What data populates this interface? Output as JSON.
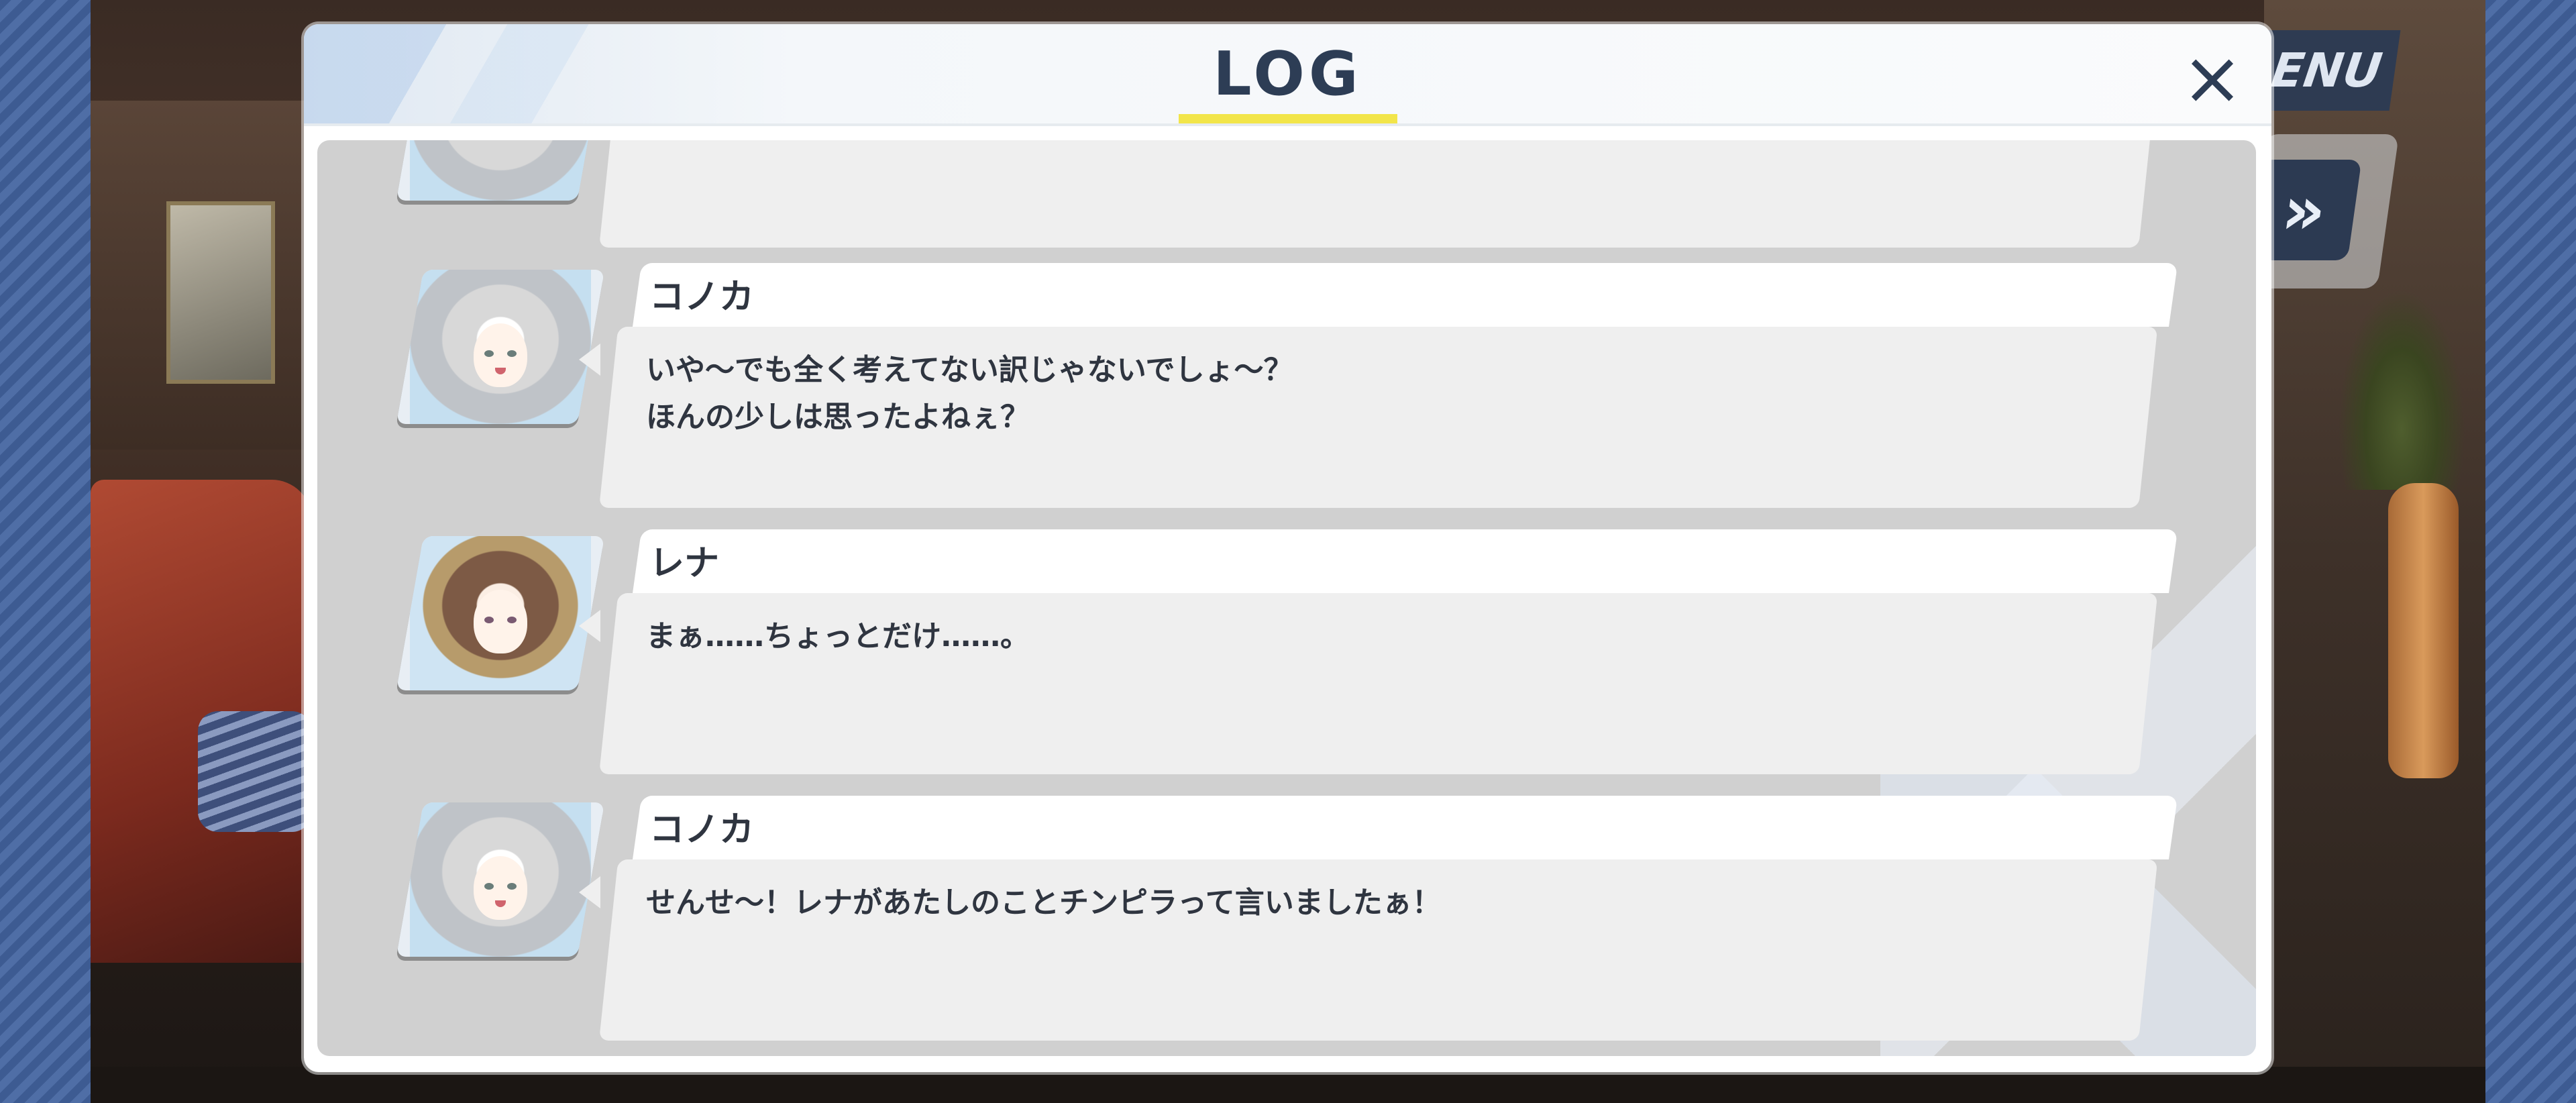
{
  "background": {
    "menu_label": "ENU",
    "skip_label": "»"
  },
  "log": {
    "title": "LOG",
    "close_icon": "×",
    "accent_color": "#f2e54a",
    "entries": [
      {
        "name": "コノカ",
        "avatar": "konoka-portrait",
        "text": "いや～でも全く考えてない訳じゃないでしょ～？\nほんの少しは思ったよねぇ？"
      },
      {
        "name": "レナ",
        "avatar": "rena-portrait",
        "text": "まぁ……ちょっとだけ……。"
      },
      {
        "name": "コノカ",
        "avatar": "konoka-portrait",
        "text": "せんせ～！レナがあたしのことチンピラって言いましたぁ！"
      }
    ]
  }
}
